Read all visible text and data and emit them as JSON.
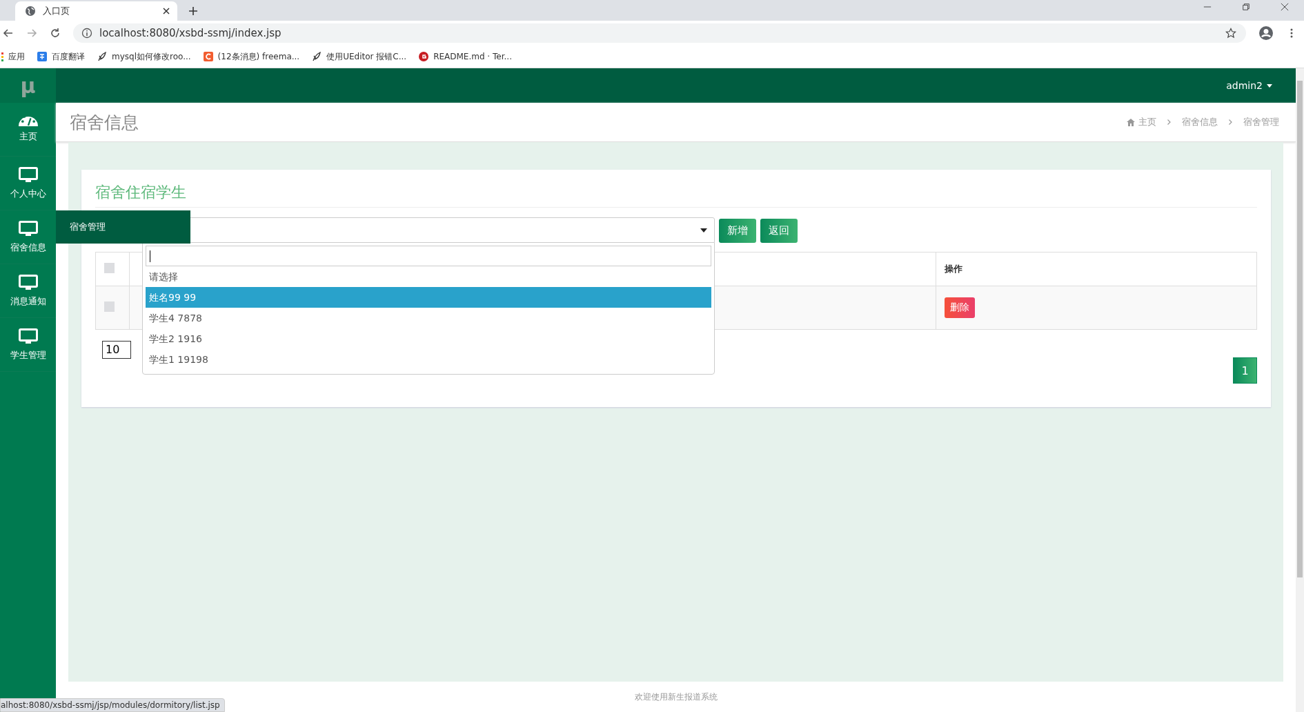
{
  "browser": {
    "tab_title": "入口页",
    "url": "localhost:8080/xsbd-ssmj/index.jsp",
    "bookmarks": [
      {
        "label": "应用",
        "kind": "apps"
      },
      {
        "label": "百度翻译",
        "kind": "translate"
      },
      {
        "label": "mysql如何修改roo...",
        "kind": "feather"
      },
      {
        "label": "(12条消息) freema...",
        "kind": "csdn"
      },
      {
        "label": "使用UEditor 报错C...",
        "kind": "feather"
      },
      {
        "label": "README.md · Ter...",
        "kind": "gitee"
      }
    ]
  },
  "sidebar": {
    "logo": "μ",
    "items": [
      {
        "label": "主页",
        "kind": "dashboard"
      },
      {
        "label": "个人中心",
        "kind": "monitor"
      },
      {
        "label": "宿舍信息",
        "kind": "monitor",
        "submenu": [
          "宿舍管理"
        ]
      },
      {
        "label": "消息通知",
        "kind": "monitor"
      },
      {
        "label": "学生管理",
        "kind": "monitor"
      }
    ]
  },
  "header": {
    "user": "admin2"
  },
  "page_title": "宿舍信息",
  "breadcrumb": [
    "主页",
    "宿舍信息",
    "宿舍管理"
  ],
  "card": {
    "title": "宿舍住宿学生",
    "select": {
      "open": true,
      "options": [
        {
          "label": "请选择",
          "selected": false
        },
        {
          "label": "姓名99 99",
          "selected": true
        },
        {
          "label": "学生4 7878",
          "selected": false
        },
        {
          "label": "学生2 1916",
          "selected": false
        },
        {
          "label": "学生1 19198",
          "selected": false
        }
      ]
    },
    "buttons": [
      {
        "label": "新增",
        "kind": "primary"
      },
      {
        "label": "返回",
        "kind": "primary"
      }
    ],
    "table": {
      "header_checked": false,
      "columns": [
        "操作"
      ],
      "rows": [
        {
          "checked": false,
          "action": "删除"
        }
      ]
    },
    "page_size": "10",
    "pages": [
      {
        "label": "1",
        "selected": true
      }
    ]
  },
  "footer": "欢迎使用新生报道系统",
  "status_url": "alhost:8080/xsbd-ssmj/jsp/modules/dormitory/list.jsp"
}
